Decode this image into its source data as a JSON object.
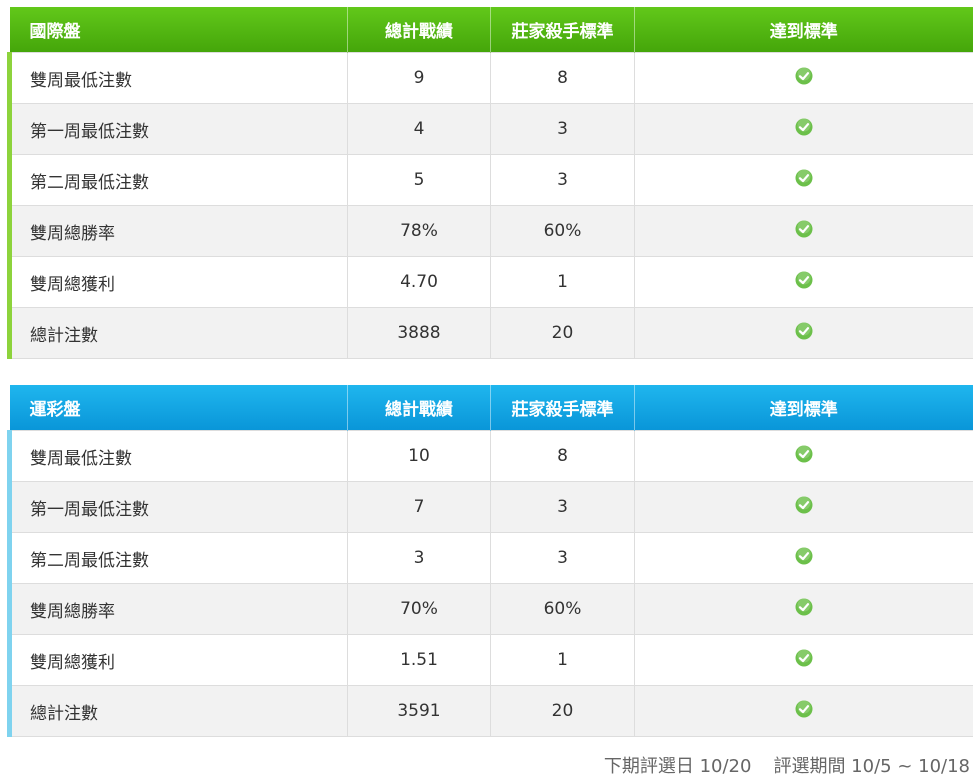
{
  "colors": {
    "green_header": "#44a50a",
    "blue_header": "#0995d8",
    "check": "#6cc04a"
  },
  "tables": [
    {
      "id": "intl",
      "headers": [
        "國際盤",
        "總計戰績",
        "莊家殺手標準",
        "達到標準"
      ],
      "rows": [
        {
          "label": "雙周最低注數",
          "total": "9",
          "standard": "8",
          "met": true
        },
        {
          "label": "第一周最低注數",
          "total": "4",
          "standard": "3",
          "met": true
        },
        {
          "label": "第二周最低注數",
          "total": "5",
          "standard": "3",
          "met": true
        },
        {
          "label": "雙周總勝率",
          "total": "78%",
          "standard": "60%",
          "met": true
        },
        {
          "label": "雙周總獲利",
          "total": "4.70",
          "standard": "1",
          "met": true
        },
        {
          "label": "總計注數",
          "total": "3888",
          "standard": "20",
          "met": true
        }
      ]
    },
    {
      "id": "sports",
      "headers": [
        "運彩盤",
        "總計戰績",
        "莊家殺手標準",
        "達到標準"
      ],
      "rows": [
        {
          "label": "雙周最低注數",
          "total": "10",
          "standard": "8",
          "met": true
        },
        {
          "label": "第一周最低注數",
          "total": "7",
          "standard": "3",
          "met": true
        },
        {
          "label": "第二周最低注數",
          "total": "3",
          "standard": "3",
          "met": true
        },
        {
          "label": "雙周總勝率",
          "total": "70%",
          "standard": "60%",
          "met": true
        },
        {
          "label": "雙周總獲利",
          "total": "1.51",
          "standard": "1",
          "met": true
        },
        {
          "label": "總計注數",
          "total": "3591",
          "standard": "20",
          "met": true
        }
      ]
    }
  ],
  "footer": {
    "next_selection": "下期評選日 10/20",
    "period": "評選期間 10/5 ~ 10/18"
  },
  "icons": {
    "met": "check-circle-icon"
  }
}
